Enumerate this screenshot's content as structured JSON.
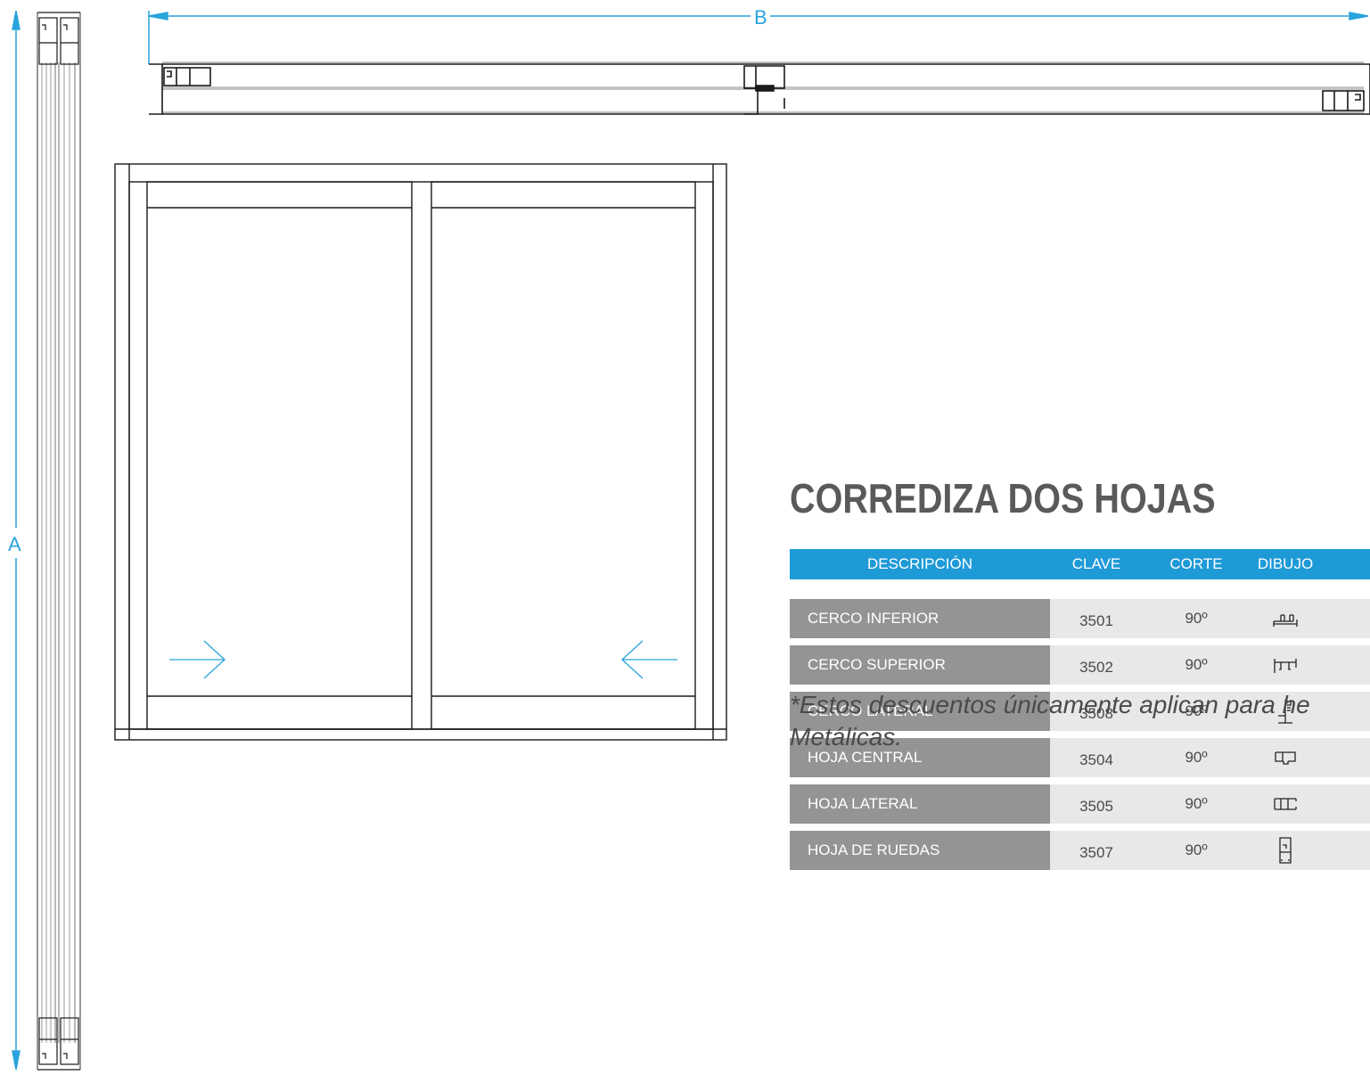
{
  "dimensions": {
    "width_label": "B",
    "height_label": "A"
  },
  "title": "CORREDIZA DOS HOJAS",
  "table": {
    "headers": {
      "description": "DESCRIPCIÓN",
      "key": "CLAVE",
      "cut": "CORTE",
      "drawing": "DIBUJO"
    },
    "rows": [
      {
        "description": "CERCO INFERIOR",
        "key": "3501",
        "cut": "90º",
        "icon": "cerco-inferior-profile-icon"
      },
      {
        "description": "CERCO SUPERIOR",
        "key": "3502",
        "cut": "90º",
        "icon": "cerco-superior-profile-icon"
      },
      {
        "description": "CERCO LATERAL",
        "key": "3508",
        "cut": "90º",
        "icon": "cerco-lateral-profile-icon"
      },
      {
        "description": "HOJA CENTRAL",
        "key": "3504",
        "cut": "90º",
        "icon": "hoja-central-profile-icon"
      },
      {
        "description": "HOJA LATERAL",
        "key": "3505",
        "cut": "90º",
        "icon": "hoja-lateral-profile-icon"
      },
      {
        "description": "HOJA DE RUEDAS",
        "key": "3507",
        "cut": "90º",
        "icon": "hoja-ruedas-profile-icon"
      }
    ]
  },
  "note": {
    "line1": "*Estos descuentos únicamente aplican para he",
    "line2": "Metálicas."
  },
  "colors": {
    "accent": "#1e9ad7",
    "title": "#5a5a5a",
    "row_label_bg": "#949494",
    "row_bg": "#e8e8e8"
  }
}
